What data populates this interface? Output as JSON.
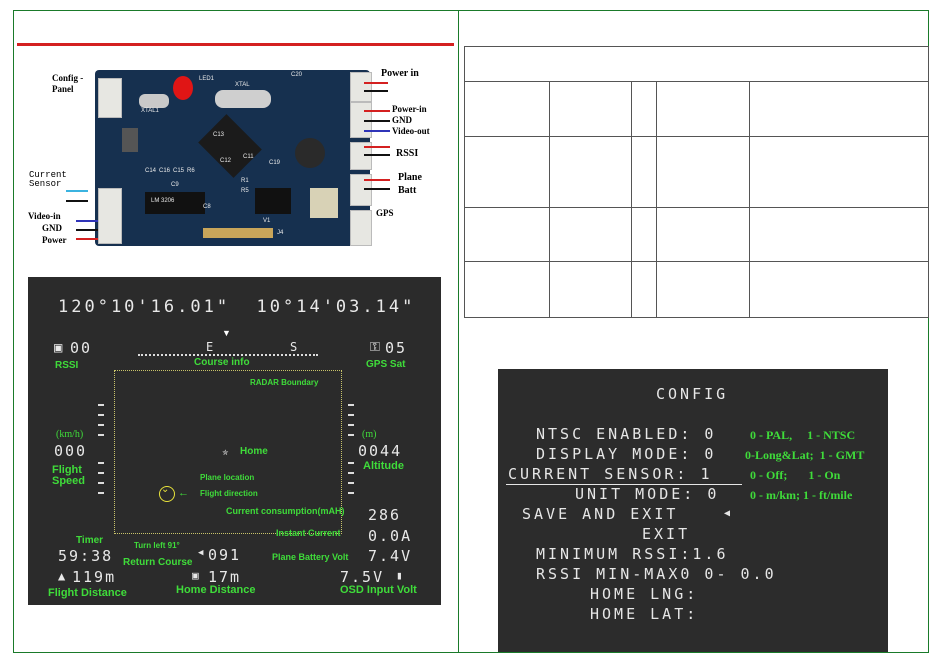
{
  "pcb": {
    "labels": {
      "config_panel": "Config -\nPanel",
      "current_sensor": "Current\nSensor",
      "video_in": "Video-in",
      "gnd_left": "GND",
      "power_left": "Power",
      "power_in_top": "Power in",
      "power_in": "Power-in",
      "gnd_right": "GND",
      "video_out": "Video-out",
      "rssi": "RSSI",
      "plane": "Plane",
      "batt": "Batt",
      "gps": "GPS"
    },
    "silkscreen": {
      "led": "LED1",
      "xtal1": "XTAL1",
      "xtal": "XTAL",
      "c20": "C20",
      "c13": "C13",
      "c12": "C12",
      "c11": "C11",
      "c19": "C19",
      "c14": "C14",
      "c16": "C16",
      "c15": "C15",
      "r6": "R6",
      "c9": "C9",
      "r1": "R1",
      "r5": "R5",
      "c8": "C8",
      "j4": "J4",
      "v1": "V1",
      "chip_text": "LM 3206"
    }
  },
  "osd": {
    "coords": "120°10'16.01\"  10°14'03.14\"",
    "rssi_value": "00",
    "rssi_label": "RSSI",
    "course_label": "Course info",
    "compass_e": "E",
    "compass_s": "S",
    "gps_value": "05",
    "gps_label": "GPS Sat",
    "radar_label": "RADAR Boundary",
    "speed_unit": "(km/h)",
    "speed_value": "000",
    "speed_label": "Flight\nSpeed",
    "home_label": "Home",
    "alt_unit": "(m)",
    "alt_value": "0044",
    "alt_label": "Altitude",
    "plane_location": "Plane location",
    "flight_direction": "Flight direction",
    "consumption_label": "Current consumption(mAH)",
    "consumption_value": "286",
    "instant_label": "Instant Current",
    "instant_value": "0.0A",
    "timer_label": "Timer",
    "timer_value": "59:38",
    "turn_label": "Turn left 91°",
    "return_label": "Return Course",
    "return_value": "091",
    "battery_label": "Plane Battery Volt",
    "battery_value": "7.4V",
    "distance_value": "119m",
    "home_distance_value": "17m",
    "osd_volt_value": "7.5V",
    "flight_distance_label": "Flight Distance",
    "home_distance_label": "Home Distance",
    "osd_volt_label": "OSD Input Volt"
  },
  "config": {
    "title": "CONFIG",
    "rows": [
      {
        "text": "NTSC ENABLED: 0",
        "note": "0 - PAL,     1 - NTSC"
      },
      {
        "text": "DISPLAY MODE: 0",
        "note": "0-Long&Lat;  1 - GMT"
      },
      {
        "text": "CURRENT SENSOR: 1",
        "note": "0 - Off;       1 - On"
      },
      {
        "text": "UNIT MODE: 0",
        "note": "0 - m/km; 1 - ft/mile"
      },
      {
        "text": "SAVE AND EXIT",
        "note": ""
      },
      {
        "text": "EXIT",
        "note": ""
      },
      {
        "text": "MINIMUM RSSI:1.6",
        "note": ""
      },
      {
        "text": "RSSI MIN-MAX0 0- 0.0",
        "note": ""
      },
      {
        "text": "HOME LNG:",
        "note": ""
      },
      {
        "text": "HOME LAT:",
        "note": ""
      }
    ]
  }
}
